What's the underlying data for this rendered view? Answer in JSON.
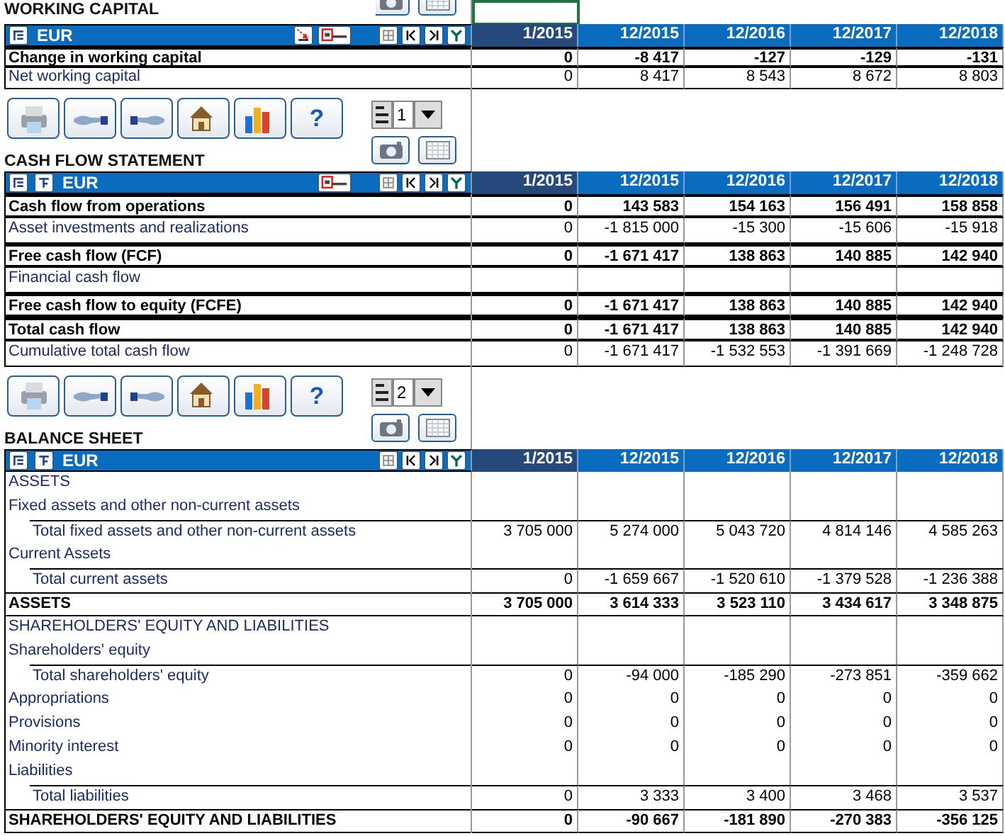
{
  "sections": [
    {
      "title": "WORKING CAPITAL",
      "selected_cell": true,
      "ruled": true,
      "currency": "EUR",
      "header_tools": [
        {
          "kind": "outline"
        },
        {
          "kind": "zero"
        },
        {
          "kind": "scale"
        },
        {
          "kind": "grid"
        },
        {
          "kind": "first"
        },
        {
          "kind": "last"
        },
        {
          "kind": "filter"
        }
      ],
      "columns": [
        {
          "label": "1/2015",
          "kind": "actual"
        },
        {
          "label": "12/2015",
          "kind": "plan"
        },
        {
          "label": "12/2016",
          "kind": "plan"
        },
        {
          "label": "12/2017",
          "kind": "plan"
        },
        {
          "label": "12/2018",
          "kind": "plan"
        }
      ],
      "rows": [
        {
          "label": "Change in working capital",
          "bold": true,
          "values": [
            "0",
            "-8 417",
            "-127",
            "-129",
            "-131"
          ]
        },
        {
          "label": "Net working capital",
          "bold": false,
          "values": [
            "0",
            "8 417",
            "8 543",
            "8 672",
            "8 803"
          ]
        }
      ]
    },
    {
      "title": "CASH FLOW STATEMENT",
      "ruled": true,
      "currency": "EUR",
      "toolbar": {
        "buttons": [
          {
            "kind": "print"
          },
          {
            "kind": "back"
          },
          {
            "kind": "forward"
          },
          {
            "kind": "home"
          },
          {
            "kind": "chart"
          },
          {
            "kind": "help",
            "label": "?"
          }
        ],
        "spinner": "1"
      },
      "header_tools": [
        {
          "kind": "outline"
        },
        {
          "kind": "collapse"
        },
        {
          "kind": "scale"
        },
        {
          "kind": "grid"
        },
        {
          "kind": "first"
        },
        {
          "kind": "last"
        },
        {
          "kind": "filter"
        }
      ],
      "columns": [
        {
          "label": "1/2015",
          "kind": "actual"
        },
        {
          "label": "12/2015",
          "kind": "plan"
        },
        {
          "label": "12/2016",
          "kind": "plan"
        },
        {
          "label": "12/2017",
          "kind": "plan"
        },
        {
          "label": "12/2018",
          "kind": "plan"
        }
      ],
      "rows": [
        {
          "label": "Cash flow from operations",
          "bold": true,
          "values": [
            "0",
            "143 583",
            "154 163",
            "156 491",
            "158 858"
          ]
        },
        {
          "label": "Asset investments and realizations",
          "bold": false,
          "values": [
            "0",
            "-1 815 000",
            "-15 300",
            "-15 606",
            "-15 918"
          ]
        },
        {
          "label": "Free cash flow (FCF)",
          "bold": true,
          "values": [
            "0",
            "-1 671 417",
            "138 863",
            "140 885",
            "142 940"
          ]
        },
        {
          "label": "Financial cash flow",
          "bold": false
        },
        {
          "label": "Free cash flow to equity (FCFE)",
          "bold": true,
          "values": [
            "0",
            "-1 671 417",
            "138 863",
            "140 885",
            "142 940"
          ]
        },
        {
          "label": "Total cash flow",
          "bold": true,
          "values": [
            "0",
            "-1 671 417",
            "138 863",
            "140 885",
            "142 940"
          ]
        },
        {
          "label": "Cumulative total cash flow",
          "bold": false,
          "values": [
            "0",
            "-1 671 417",
            "-1 532 553",
            "-1 391 669",
            "-1 248 728"
          ]
        }
      ]
    },
    {
      "title": "BALANCE SHEET",
      "ruled": false,
      "currency": "EUR",
      "toolbar": {
        "buttons": [
          {
            "kind": "print"
          },
          {
            "kind": "back"
          },
          {
            "kind": "forward"
          },
          {
            "kind": "home"
          },
          {
            "kind": "chart"
          },
          {
            "kind": "help",
            "label": "?"
          }
        ],
        "spinner": "2"
      },
      "header_tools": [
        {
          "kind": "outline"
        },
        {
          "kind": "collapse"
        },
        {
          "kind": "grid"
        },
        {
          "kind": "first"
        },
        {
          "kind": "last"
        },
        {
          "kind": "filter"
        }
      ],
      "columns": [
        {
          "label": "1/2015",
          "kind": "actual"
        },
        {
          "label": "12/2015",
          "kind": "plan"
        },
        {
          "label": "12/2016",
          "kind": "plan"
        },
        {
          "label": "12/2017",
          "kind": "plan"
        },
        {
          "label": "12/2018",
          "kind": "plan"
        }
      ],
      "rows": [
        {
          "label": "ASSETS",
          "bold": false
        },
        {
          "label": "Fixed assets and other non-current assets",
          "bold": false,
          "children": [
            {
              "label": "Total fixed assets and other non-current assets",
              "bold": false,
              "values": [
                "3 705 000",
                "5 274 000",
                "5 043 720",
                "4 814 146",
                "4 585 263"
              ]
            }
          ]
        },
        {
          "label": "Current Assets",
          "bold": false,
          "children": [
            {
              "label": "Total current assets",
              "bold": false,
              "values": [
                "0",
                "-1 659 667",
                "-1 520 610",
                "-1 379 528",
                "-1 236 388"
              ]
            }
          ]
        },
        {
          "label": "ASSETS",
          "bold": true,
          "values": [
            "3 705 000",
            "3 614 333",
            "3 523 110",
            "3 434 617",
            "3 348 875"
          ]
        },
        {
          "label": "SHAREHOLDERS' EQUITY AND LIABILITIES",
          "bold": false
        },
        {
          "label": "Shareholders' equity",
          "bold": false,
          "children": [
            {
              "label": "Total shareholders' equity",
              "bold": false,
              "values": [
                "0",
                "-94 000",
                "-185 290",
                "-273 851",
                "-359 662"
              ]
            }
          ]
        },
        {
          "label": "Appropriations",
          "bold": false,
          "values": [
            "0",
            "0",
            "0",
            "0",
            "0"
          ]
        },
        {
          "label": "Provisions",
          "bold": false,
          "values": [
            "0",
            "0",
            "0",
            "0",
            "0"
          ]
        },
        {
          "label": "Minority interest",
          "bold": false,
          "values": [
            "0",
            "0",
            "0",
            "0",
            "0"
          ]
        },
        {
          "label": "Liabilities",
          "bold": false,
          "children": [
            {
              "label": "Total liabilities",
              "bold": false,
              "values": [
                "0",
                "3 333",
                "3 400",
                "3 468",
                "3 537"
              ]
            }
          ]
        },
        {
          "label": "SHAREHOLDERS' EQUITY AND LIABILITIES",
          "bold": true,
          "values": [
            "0",
            "-90 667",
            "-181 890",
            "-270 383",
            "-356 125"
          ]
        }
      ]
    }
  ]
}
